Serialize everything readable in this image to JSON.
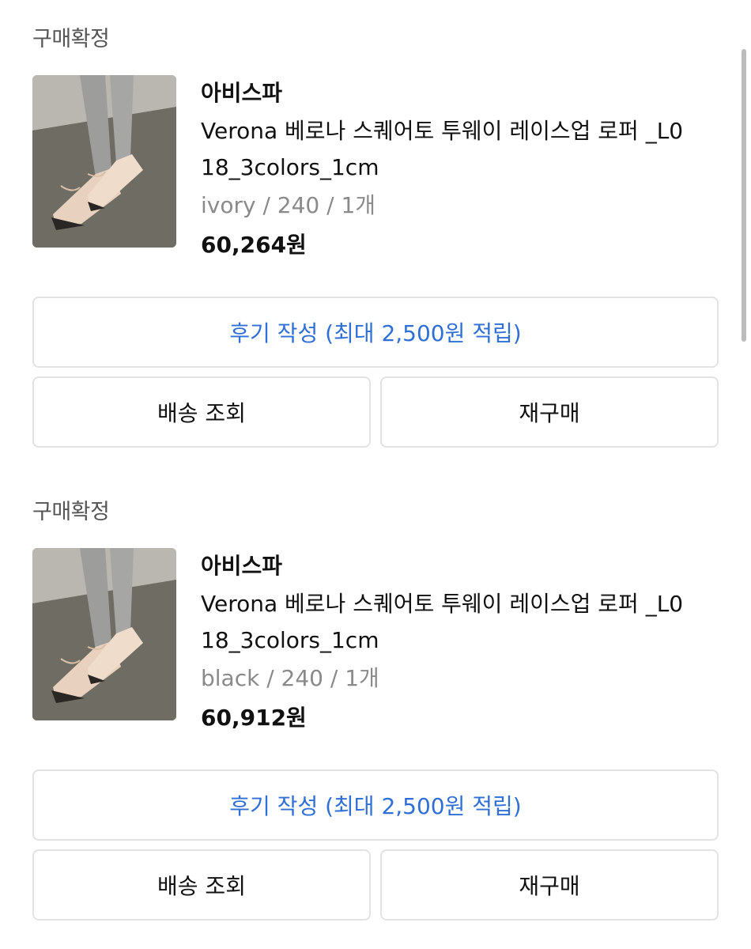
{
  "orders": [
    {
      "status": "구매확정",
      "image": "loafer-product-photo",
      "brand": "아비스파",
      "product_name": "Verona 베로나 스퀘어토 투웨이 레이스업 로퍼 _L018_3colors_1cm",
      "options": "ivory / 240 / 1개",
      "price": "60,264원",
      "review_button": "후기 작성 (최대 2,500원 적립)",
      "tracking_button": "배송 조회",
      "reorder_button": "재구매"
    },
    {
      "status": "구매확정",
      "image": "loafer-product-photo",
      "brand": "아비스파",
      "product_name": "Verona 베로나 스퀘어토 투웨이 레이스업 로퍼 _L018_3colors_1cm",
      "options": "black / 240 / 1개",
      "price": "60,912원",
      "review_button": "후기 작성 (최대 2,500원 적립)",
      "tracking_button": "배송 조회",
      "reorder_button": "재구매"
    }
  ],
  "colors": {
    "accent": "#2f6fd6",
    "muted_text": "#8a8a8a",
    "border": "#e3e3e3"
  }
}
